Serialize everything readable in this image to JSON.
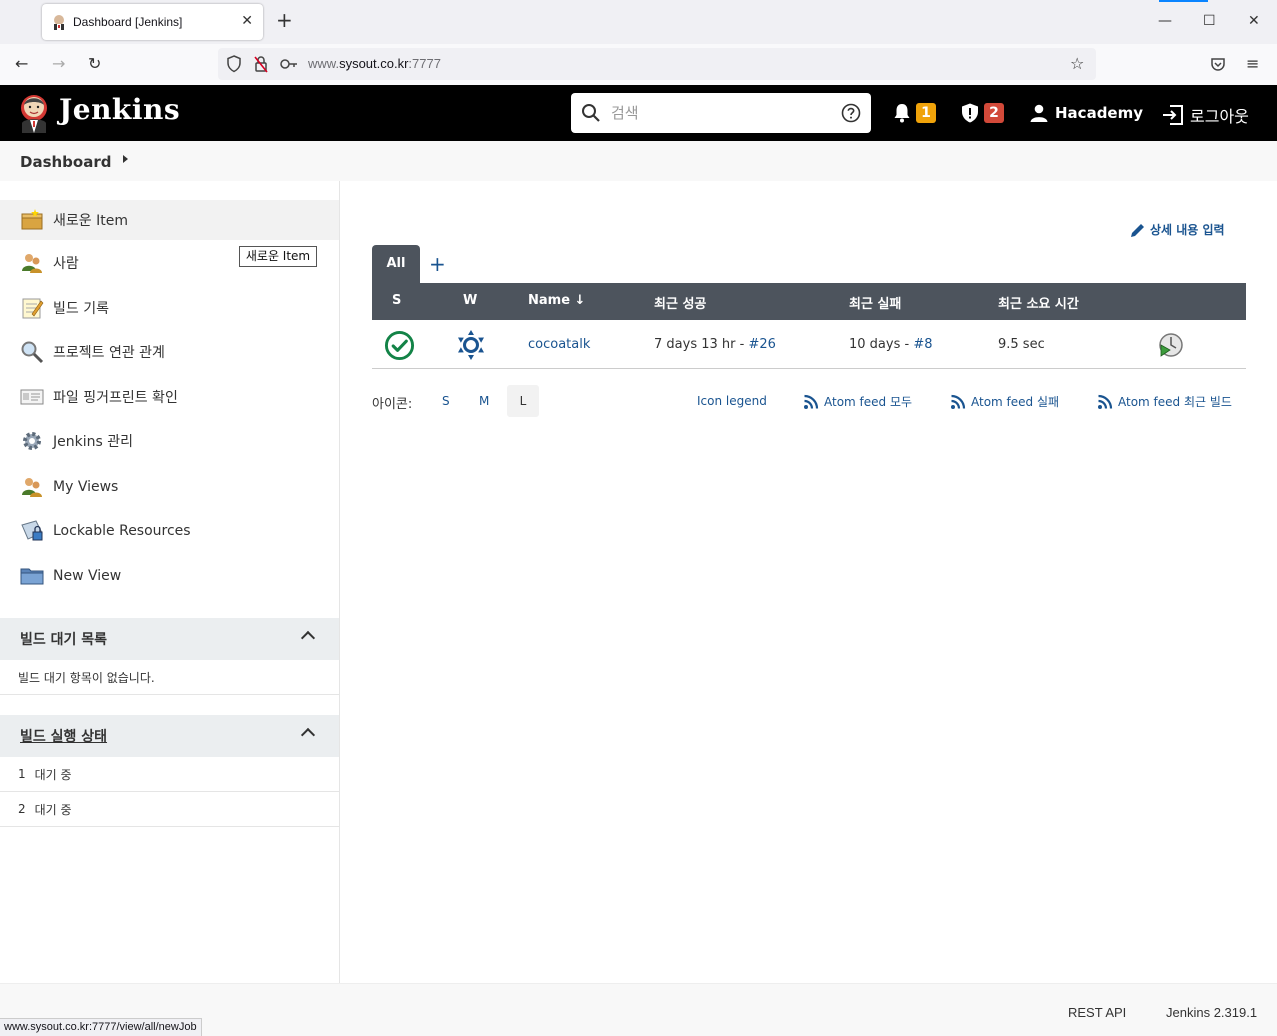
{
  "browser": {
    "tab_title": "Dashboard [Jenkins]",
    "url_gray": "www.",
    "url_main": "sysout.co.kr",
    "url_port": ":7777",
    "status_url": "www.sysout.co.kr:7777/view/all/newJob"
  },
  "header": {
    "brand": "Jenkins",
    "search_placeholder": "검색",
    "notifications_count": "1",
    "security_count": "2",
    "user": "Hacademy",
    "logout": "로그아웃",
    "notif_color": "#f0a30a",
    "security_color": "#d24939"
  },
  "breadcrumb": {
    "dashboard": "Dashboard"
  },
  "sidebar": {
    "tasks": [
      {
        "label": "새로운 Item",
        "icon": "new-item-icon"
      },
      {
        "label": "사람",
        "icon": "people-icon"
      },
      {
        "label": "빌드 기록",
        "icon": "notepad-icon"
      },
      {
        "label": "프로젝트 연관 관계",
        "icon": "magnifier-icon"
      },
      {
        "label": "파일 핑거프린트 확인",
        "icon": "fingerprint-icon"
      },
      {
        "label": "Jenkins 관리",
        "icon": "gear-icon"
      },
      {
        "label": "My Views",
        "icon": "people-icon"
      },
      {
        "label": "Lockable Resources",
        "icon": "lockable-resources-icon"
      },
      {
        "label": "New View",
        "icon": "folder-icon"
      }
    ],
    "tooltip": "새로운 Item",
    "queue": {
      "title": "빌드 대기 목록",
      "empty": "빌드 대기 항목이 없습니다."
    },
    "executors": {
      "title": "빌드 실행 상태",
      "rows": [
        {
          "num": "1",
          "label": "대기 중"
        },
        {
          "num": "2",
          "label": "대기 중"
        }
      ]
    }
  },
  "main": {
    "edit_description": "상세 내용 입력",
    "view_tab": "All",
    "add_tab": "+",
    "columns": {
      "s": "S",
      "w": "W",
      "name": "Name ↓",
      "last_success": "최근 성공",
      "last_failure": "최근 실패",
      "last_duration": "최근 소요 시간"
    },
    "jobs": [
      {
        "name": "cocoatalk",
        "last_success_text": "7 days 13 hr - ",
        "last_success_build": "#26",
        "last_failure_text": "10 days - ",
        "last_failure_build": "#8",
        "duration": "9.5 sec",
        "status_color": "#138347",
        "weather_color": "#1a5490"
      }
    ],
    "legend": {
      "icon_label": "아이콘:",
      "sizes": [
        "S",
        "M",
        "L"
      ],
      "icon_legend": "Icon legend",
      "feed_all": "Atom feed 모두",
      "feed_fail": "Atom feed 실패",
      "feed_latest": "Atom feed 최근 빌드"
    }
  },
  "footer": {
    "rest_api": "REST API",
    "version": "Jenkins 2.319.1"
  }
}
